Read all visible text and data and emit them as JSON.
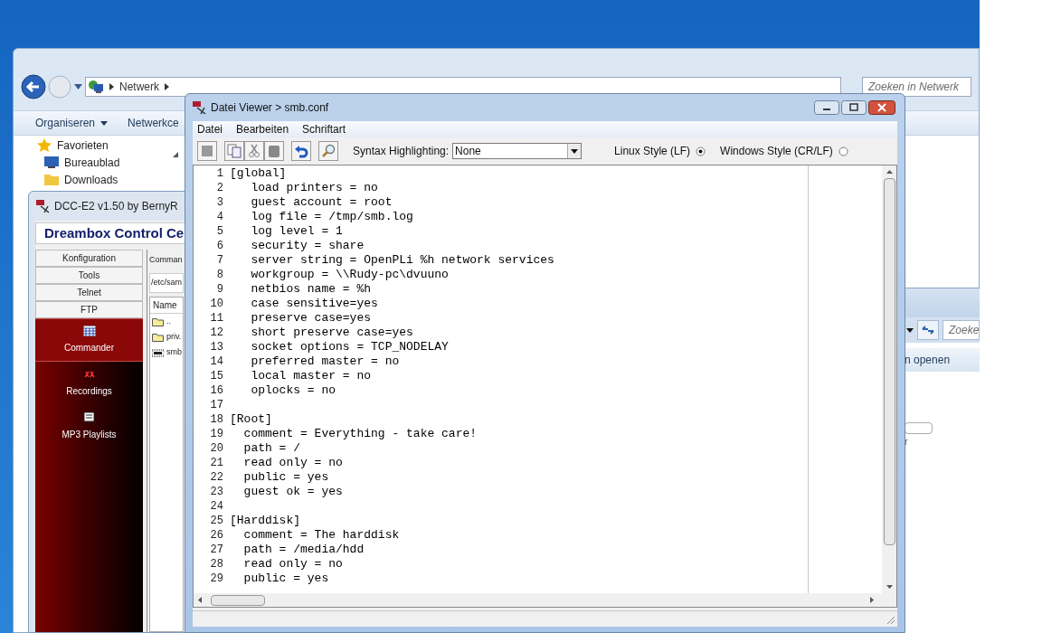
{
  "explorer": {
    "address": "Netwerk",
    "search_placeholder": "Zoeken in Netwerk",
    "toolbar": [
      "Organiseren",
      "Netwerkce"
    ],
    "nav": [
      {
        "label": "Favorieten",
        "kind": "group"
      },
      {
        "label": "Bureaublad",
        "kind": "desktop"
      },
      {
        "label": "Downloads",
        "kind": "folder"
      }
    ]
  },
  "explorer_back": {
    "search_placeholder": "Zoeke",
    "toolbar_text": "n openen",
    "label": "r"
  },
  "dcc": {
    "title": "DCC-E2 v1.50 by BernyR",
    "header": "Dreambox Control Ce",
    "menu": [
      "Konfiguration",
      "Tools",
      "Telnet",
      "FTP"
    ],
    "sections": [
      {
        "label": "Commander",
        "kind": "grid",
        "selected": true
      },
      {
        "label": "Recordings",
        "kind": "film",
        "selected": false
      },
      {
        "label": "MP3 Playlists",
        "kind": "music",
        "selected": false
      }
    ],
    "panel_title": "Comman",
    "path": "/etc/sam",
    "column": "Name",
    "files": [
      {
        "name": "..",
        "kind": "folder"
      },
      {
        "name": "priv.",
        "kind": "folder"
      },
      {
        "name": "smb",
        "kind": "file"
      }
    ]
  },
  "viewer": {
    "title": "Datei Viewer > smb.conf",
    "menu": [
      "Datei",
      "Bearbeiten",
      "Schriftart"
    ],
    "syntax_label": "Syntax Highlighting:",
    "syntax_value": "None",
    "line_styles": [
      {
        "label": "Linux Style (LF)",
        "selected": true
      },
      {
        "label": "Windows Style (CR/LF)",
        "selected": false
      }
    ],
    "lines": [
      {
        "number": "1",
        "text": "[global]"
      },
      {
        "number": "2",
        "text": "   load printers = no"
      },
      {
        "number": "3",
        "text": "   guest account = root"
      },
      {
        "number": "4",
        "text": "   log file = /tmp/smb.log"
      },
      {
        "number": "5",
        "text": "   log level = 1"
      },
      {
        "number": "6",
        "text": "   security = share"
      },
      {
        "number": "7",
        "text": "   server string = OpenPLi %h network services"
      },
      {
        "number": "8",
        "text": "   workgroup = \\\\Rudy-pc\\dvuuno"
      },
      {
        "number": "9",
        "text": "   netbios name = %h"
      },
      {
        "number": "10",
        "text": "   case sensitive=yes"
      },
      {
        "number": "11",
        "text": "   preserve case=yes"
      },
      {
        "number": "12",
        "text": "   short preserve case=yes"
      },
      {
        "number": "13",
        "text": "   socket options = TCP_NODELAY"
      },
      {
        "number": "14",
        "text": "   preferred master = no"
      },
      {
        "number": "15",
        "text": "   local master = no"
      },
      {
        "number": "16",
        "text": "   oplocks = no"
      },
      {
        "number": "17"
      },
      {
        "number": "18",
        "text": "[Root]"
      },
      {
        "number": "19",
        "text": "  comment = Everything - take care!"
      },
      {
        "number": "20",
        "text": "  path = /"
      },
      {
        "number": "21",
        "text": "  read only = no"
      },
      {
        "number": "22",
        "text": "  public = yes"
      },
      {
        "number": "23",
        "text": "  guest ok = yes"
      },
      {
        "number": "24"
      },
      {
        "number": "25",
        "text": "[Harddisk]"
      },
      {
        "number": "26",
        "text": "  comment = The harddisk"
      },
      {
        "number": "27",
        "text": "  path = /media/hdd"
      },
      {
        "number": "28",
        "text": "  read only = no"
      },
      {
        "number": "29",
        "text": "  public = yes"
      }
    ]
  }
}
